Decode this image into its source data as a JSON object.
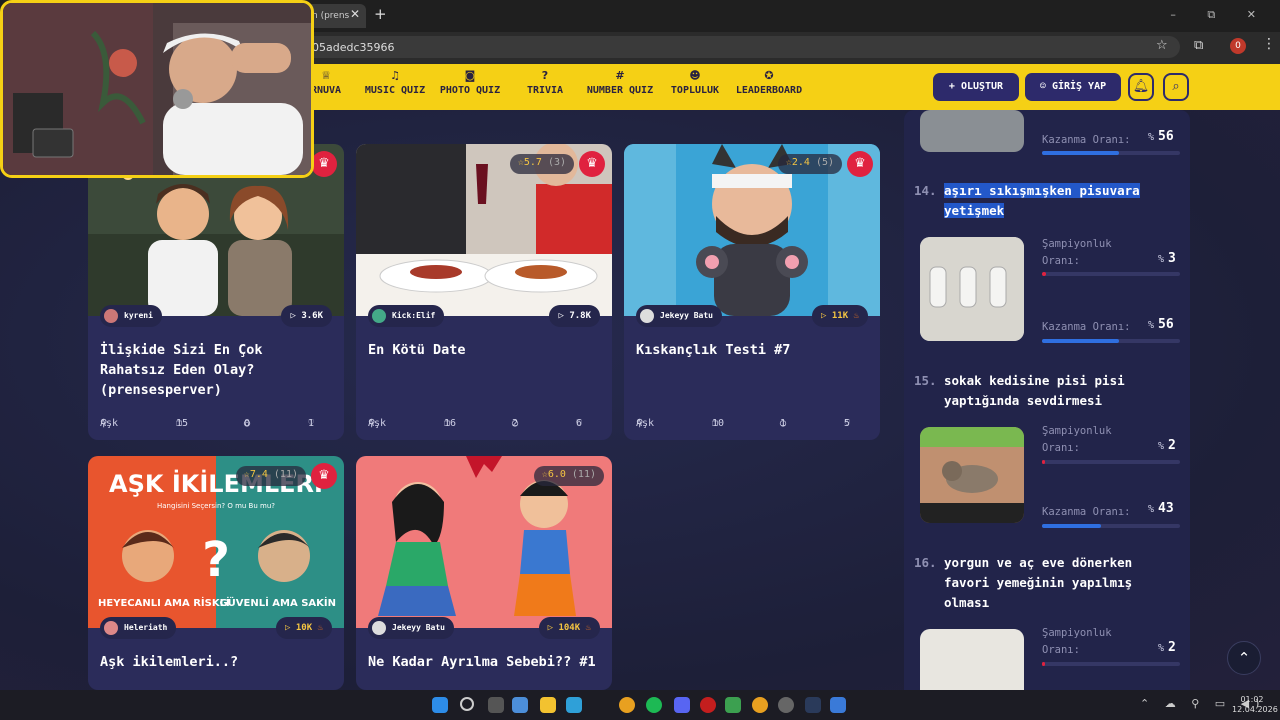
{
  "browser": {
    "tab_title": "n (prens",
    "url": "05adedc35966",
    "ext_badge": "0",
    "win_controls": "– ⧉ ✕"
  },
  "nav": {
    "items": [
      {
        "label": "RNUVA",
        "icon": "trophy-icon"
      },
      {
        "label": "MUSIC QUIZ",
        "icon": "music-icon"
      },
      {
        "label": "PHOTO QUIZ",
        "icon": "camera-icon"
      },
      {
        "label": "TRIVIA",
        "icon": "question-icon"
      },
      {
        "label": "NUMBER QUIZ",
        "icon": "hash-icon"
      },
      {
        "label": "TOPLULUK",
        "icon": "users-icon"
      },
      {
        "label": "LEADERBOARD",
        "icon": "award-icon"
      }
    ],
    "create_label": "OLUŞTUR",
    "login_label": "GİRİŞ YAP"
  },
  "cards": [
    {
      "rating": "",
      "author": "kyreni",
      "plays": "3.6K",
      "hot": false,
      "title": "İlişkide Sizi En Çok Rahatsız Eden Olay? (prensesperver)",
      "category": "Aşk",
      "count": "15",
      "comments": "0",
      "likes": "1"
    },
    {
      "rating": "5.7",
      "rating_count": "(3)",
      "author": "Kick:Elif",
      "plays": "7.8K",
      "hot": false,
      "title": "En Kötü Date",
      "category": "Aşk",
      "count": "16",
      "comments": "2",
      "likes": "6"
    },
    {
      "rating": "2.4",
      "rating_count": "(5)",
      "author": "Jekeyy Batu",
      "plays": "11K",
      "hot": true,
      "title": "Kıskançlık Testi #7",
      "category": "Aşk",
      "count": "10",
      "comments": "1",
      "likes": "5"
    },
    {
      "rating": "7.4",
      "rating_count": "(11)",
      "author": "Heleriath",
      "plays": "10K",
      "hot": true,
      "title": "Aşk ikilemleri..?",
      "thumb_top": "AŞK İKİLEMLERİ",
      "thumb_sub": "Hangisini Seçersin? O mu Bu mu?",
      "thumb_left": "HEYECANLI AMA RİSKLİ",
      "thumb_right": "GÜVENLİ AMA SAKİN"
    },
    {
      "rating": "6.0",
      "rating_count": "(11)",
      "author": "Jekeyy Batu",
      "plays": "104K",
      "hot": true,
      "title": "Ne Kadar Ayrılma Sebebi?? #1"
    }
  ],
  "sidebar": {
    "champ_label": "Şampiyonluk Oranı:",
    "win_label": "Kazanma Oranı:",
    "percent_sign": "%",
    "top_win": "56",
    "entries": [
      {
        "rank": "14.",
        "title": "aşırı sıkışmışken pisuvara yetişmek",
        "champ": "3",
        "win": "56"
      },
      {
        "rank": "15.",
        "title": "sokak kedisine pisi pisi yaptığında sevdirmesi",
        "champ": "2",
        "win": "43"
      },
      {
        "rank": "16.",
        "title": "yorgun ve aç eve dönerken favori yemeğinin yapılmış olması",
        "champ": "2"
      }
    ]
  },
  "taskbar": {
    "time": "01:02",
    "date": "12.04.2026"
  },
  "colors": {
    "accent": "#f5d015",
    "navy": "#2d2a6b",
    "crown": "#e0223f",
    "bar": "#2f6fe0"
  }
}
